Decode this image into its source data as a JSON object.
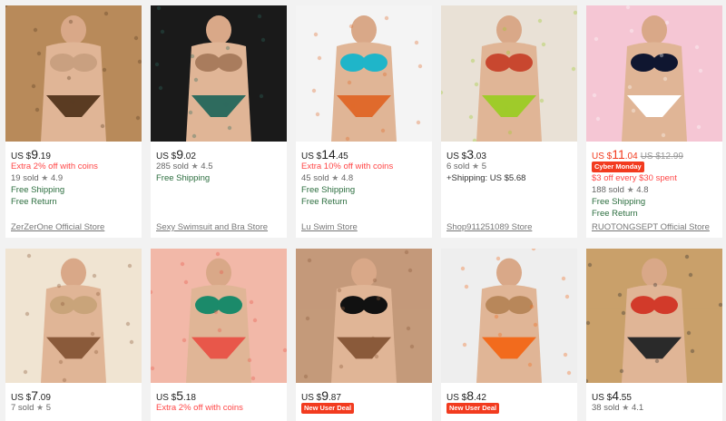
{
  "products": [
    {
      "currency": "US $",
      "price_int": "9",
      "price_dec": ".19",
      "promo": "Extra 2% off with coins",
      "sold": "19 sold",
      "rating": "4.9",
      "shipping": "Free Shipping",
      "return": "Free Return",
      "store": "ZerZerOne Official Store",
      "image": "leopard bikini model",
      "colors": [
        "#c9a080",
        "#5a3b22",
        "#b88a5a"
      ]
    },
    {
      "currency": "US $",
      "price_int": "9",
      "price_dec": ".02",
      "sold": "285 sold",
      "rating": "4.5",
      "shipping": "Free Shipping",
      "store": "Sexy Swimsuit and Bra Store",
      "image": "bikini collage four models",
      "colors": [
        "#a97c5d",
        "#2e6b5e",
        "#1a1a1a"
      ]
    },
    {
      "currency": "US $",
      "price_int": "14",
      "price_dec": ".45",
      "promo": "Extra 10% off with coins",
      "sold": "45 sold",
      "rating": "4.8",
      "shipping": "Free Shipping",
      "return": "Free Return",
      "store": "Lu Swim Store",
      "image": "long sleeve floral rash guard",
      "colors": [
        "#1fb5c9",
        "#e06a2c",
        "#f4f4f4"
      ]
    },
    {
      "currency": "US $",
      "price_int": "3",
      "price_dec": ".03",
      "sold": "6 sold",
      "rating": "5",
      "shipping_extra": "+Shipping: US $5.68",
      "store": "Shop911251089 Store",
      "image": "cut-out one piece swimsuits",
      "colors": [
        "#c8472f",
        "#9fcb2a",
        "#e9e1d6"
      ]
    },
    {
      "currency": "US $",
      "price_int": "11",
      "price_dec": ".04",
      "orig_price": "US $12.99",
      "badge": "Cyber Monday",
      "promo": "$3 off every $30 spent",
      "sold": "188 sold",
      "rating": "4.8",
      "shipping": "Free Shipping",
      "return": "Free Return",
      "store": "RUOTONGSEPT Official Store",
      "image": "polka dot bikini",
      "colors": [
        "#0f1630",
        "#ffffff",
        "#f5c6d4"
      ]
    },
    {
      "currency": "US $",
      "price_int": "7",
      "price_dec": ".09",
      "sold": "7 sold",
      "rating": "5",
      "image": "leopard bikini collage",
      "colors": [
        "#c9a47a",
        "#8a5a3a",
        "#f0e4d2"
      ]
    },
    {
      "currency": "US $",
      "price_int": "5",
      "price_dec": ".18",
      "promo": "Extra 2% off with coins",
      "image": "tropical floral bikini",
      "colors": [
        "#1b8a6a",
        "#e8574a",
        "#f2b8a8"
      ]
    },
    {
      "currency": "US $",
      "price_int": "9",
      "price_dec": ".87",
      "badge": "New User Deal",
      "image": "black and leopard bikini",
      "colors": [
        "#111111",
        "#8a5a3a",
        "#c49a7a"
      ]
    },
    {
      "currency": "US $",
      "price_int": "8",
      "price_dec": ".42",
      "badge": "New User Deal",
      "image": "snake print string bikini",
      "colors": [
        "#b8875a",
        "#f26b1d",
        "#eeeeee"
      ]
    },
    {
      "currency": "US $",
      "price_int": "4",
      "price_dec": ".55",
      "sold": "38 sold",
      "rating": "4.1",
      "image": "printed bikini grid",
      "colors": [
        "#d23a2a",
        "#2a2a2a",
        "#c9a06a"
      ]
    }
  ]
}
